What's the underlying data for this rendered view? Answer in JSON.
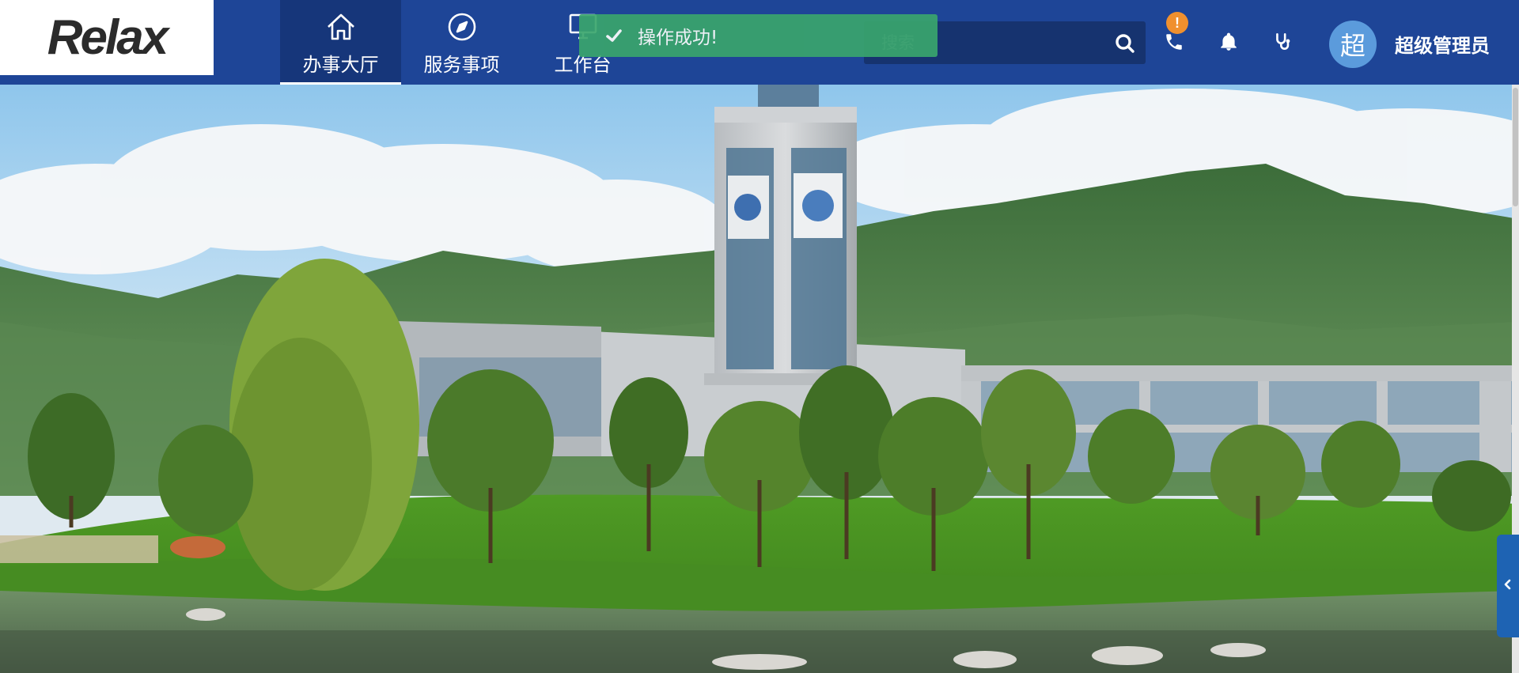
{
  "brand": {
    "logo_text": "Relax"
  },
  "nav": {
    "items": [
      {
        "label": "办事大厅",
        "icon": "home-icon",
        "active": true
      },
      {
        "label": "服务事项",
        "icon": "compass-icon",
        "active": false
      },
      {
        "label": "工作台",
        "icon": "monitor-icon",
        "active": false
      }
    ]
  },
  "search": {
    "placeholder": "搜索",
    "value": ""
  },
  "header_icons": {
    "phone_icon": "phone-icon",
    "phone_badge": "!",
    "bell_icon": "bell-icon",
    "stethoscope_icon": "stethoscope-icon"
  },
  "user": {
    "avatar_initial": "超",
    "name": "超级管理员"
  },
  "toast": {
    "message": "操作成功!",
    "type": "success",
    "icon": "check-icon"
  },
  "colors": {
    "header_bg": "#1e4597",
    "active_nav_bg": "#16367a",
    "toast_bg": "#3aa56c",
    "badge": "#f0902e",
    "avatar": "#5b9bdc",
    "side_tab": "#1e63b3"
  }
}
